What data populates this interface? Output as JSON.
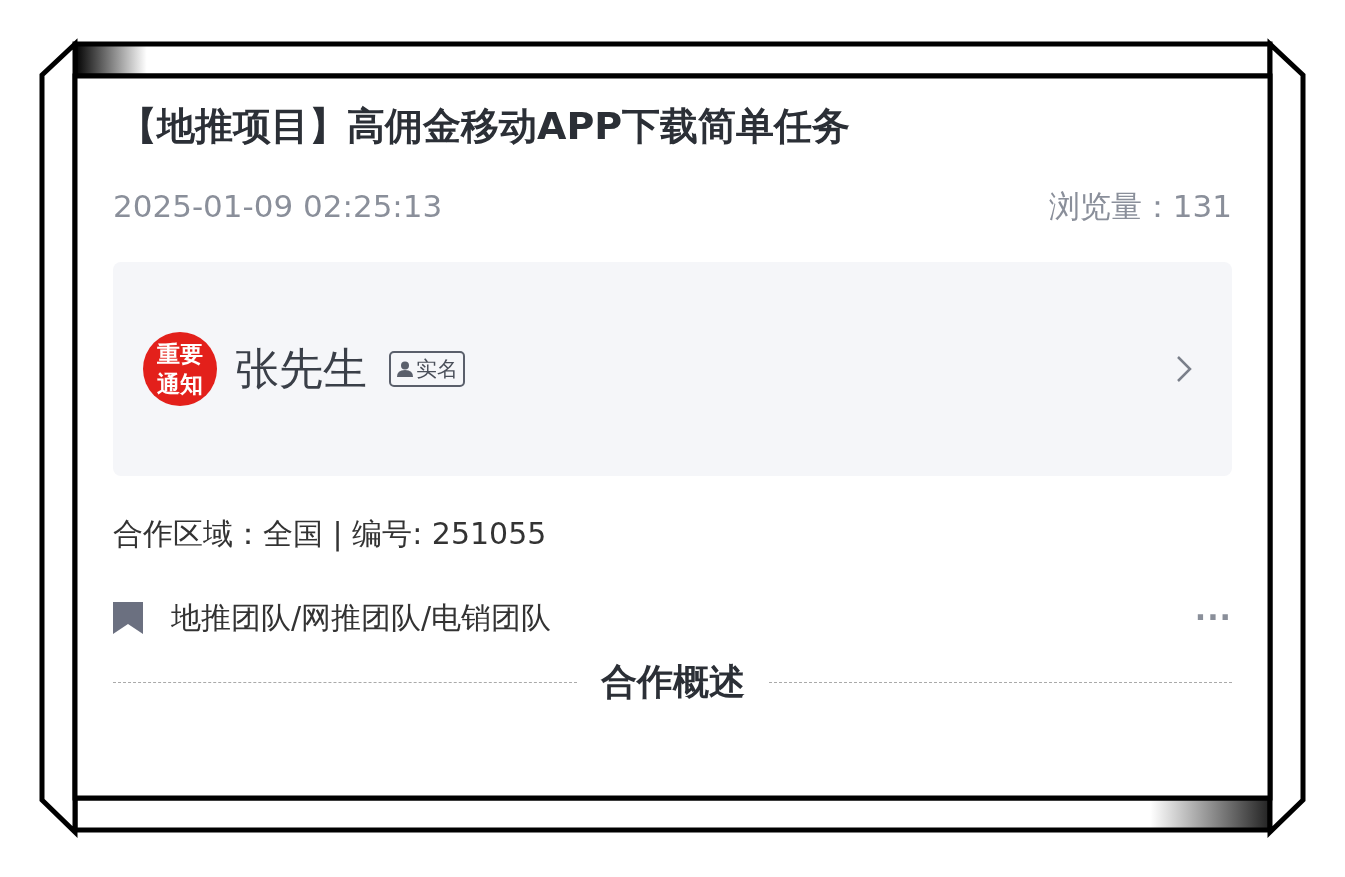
{
  "post": {
    "title": "【地推项目】高佣金移动APP下载简单任务",
    "date": "2025-01-09 02:25:13",
    "views": "浏览量：131"
  },
  "publisher": {
    "avatar_lines": [
      "重要",
      "通知"
    ],
    "name": "张先生",
    "badge": "实名"
  },
  "info": "合作区域：全国 | 编号: 251055",
  "tags": {
    "text": "地推团队/网推团队/电销团队",
    "more": "···"
  },
  "section_heading": "合作概述"
}
